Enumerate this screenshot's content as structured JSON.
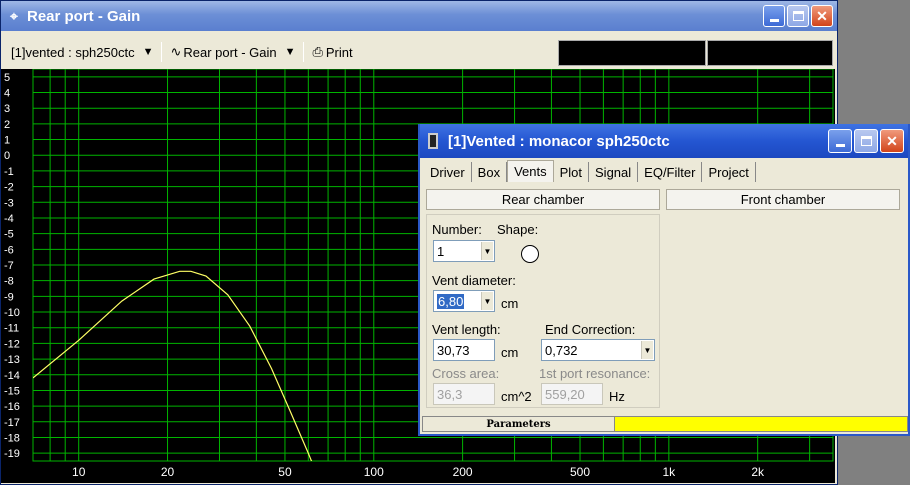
{
  "main_window": {
    "title": "Rear port - Gain",
    "toolbar": {
      "project_selector": "[1]vented : sph250ctc",
      "graph_selector": "Rear port - Gain",
      "print_label": "Print"
    }
  },
  "chart_data": {
    "type": "line",
    "title": "",
    "xlabel": "",
    "ylabel": "",
    "x_scale": "log",
    "xlim": [
      7,
      3600
    ],
    "ylim": [
      -19.5,
      5.5
    ],
    "x_tick_labels": [
      "10",
      "20",
      "50",
      "100",
      "200",
      "500",
      "1k",
      "2k"
    ],
    "x_tick_values": [
      10,
      20,
      50,
      100,
      200,
      500,
      1000,
      2000
    ],
    "y_tick_labels": [
      "5",
      "4",
      "3",
      "2",
      "1",
      "0",
      "-1",
      "-2",
      "-3",
      "-4",
      "-5",
      "-6",
      "-7",
      "-8",
      "-9",
      "-10",
      "-11",
      "-12",
      "-13",
      "-14",
      "-15",
      "-16",
      "-17",
      "-18",
      "-19"
    ],
    "grid": true,
    "series": [
      {
        "color": "#ffff66",
        "x": [
          7,
          10,
          14,
          18,
          22,
          24,
          27,
          32,
          38,
          45,
          52,
          60,
          64
        ],
        "y": [
          -14.2,
          -11.8,
          -9.3,
          -7.9,
          -7.4,
          -7.4,
          -7.7,
          -8.9,
          -10.9,
          -13.6,
          -16.3,
          -19.0,
          -20.3
        ]
      }
    ],
    "colors": {
      "background": "#000000",
      "grid": "#00b400",
      "tick_text": "#ffffff"
    }
  },
  "dialog": {
    "title": "[1]Vented : monacor sph250ctc",
    "tabs": [
      "Driver",
      "Box",
      "Vents",
      "Plot",
      "Signal",
      "EQ/Filter",
      "Project"
    ],
    "active_tab": "Vents",
    "rear_chamber_label": "Rear chamber",
    "front_chamber_label": "Front chamber",
    "number_label": "Number:",
    "number_value": "1",
    "shape_label": "Shape:",
    "shape_value": "circle",
    "vent_diameter_label": "Vent diameter:",
    "vent_diameter_value": "6,80",
    "vent_diameter_unit": "cm",
    "vent_length_label": "Vent length:",
    "vent_length_value": "30,73",
    "vent_length_unit": "cm",
    "end_correction_label": "End Correction:",
    "end_correction_value": "0,732",
    "cross_area_label": "Cross area:",
    "cross_area_value": "36,3",
    "cross_area_unit": "cm^2",
    "port_resonance_label": "1st port resonance:",
    "port_resonance_value": "559,20",
    "port_resonance_unit": "Hz",
    "status_label": "Parameters",
    "status_color": "#ffff00"
  }
}
